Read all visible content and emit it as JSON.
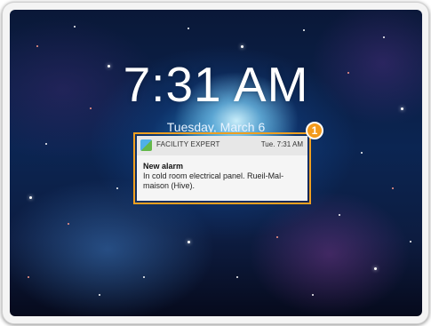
{
  "lockscreen": {
    "time": "7:31 AM",
    "date": "Tuesday, March 6"
  },
  "notification": {
    "app_name": "FACILITY EXPERT",
    "time": "Tue. 7:31 AM",
    "title": "New alarm",
    "body": "In cold room electrical panel. Rueil-Mal-maison (Hive).",
    "app_icon": "facility-expert-app-icon"
  },
  "callout": {
    "number": "1",
    "color": "#f39a1c"
  },
  "colors": {
    "highlight_border": "#f0a020"
  }
}
